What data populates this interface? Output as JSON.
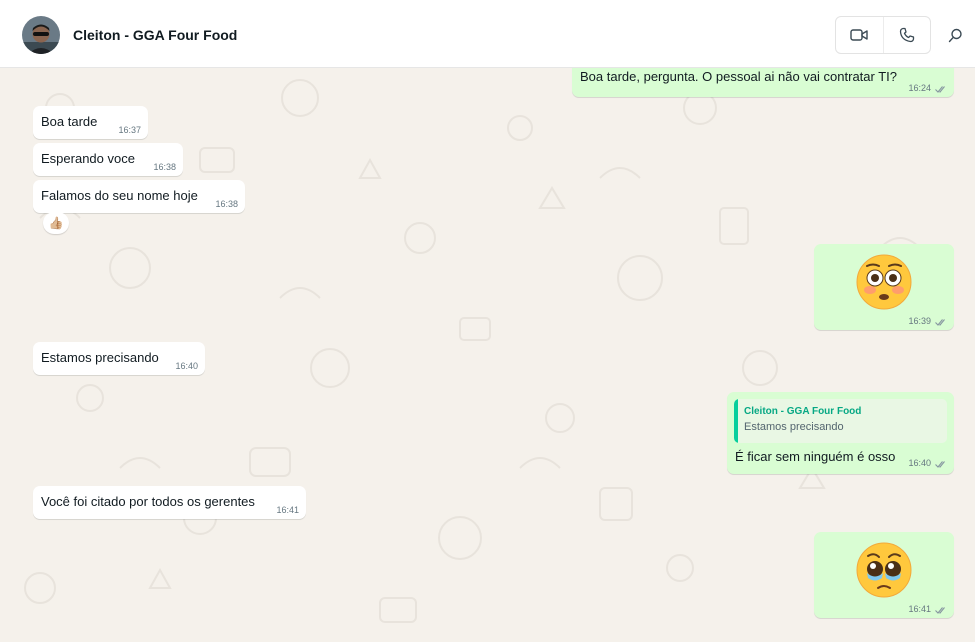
{
  "contact": {
    "name": "Cleiton - GGA Four Food"
  },
  "header_icons": [
    "video-call-icon",
    "voice-call-icon",
    "search-icon"
  ],
  "messages": [
    {
      "direction": "outgoing",
      "text": "Boa tarde, pergunta. O pessoal ai não vai contratar TI?",
      "time": "16:24",
      "status": "read"
    },
    {
      "direction": "incoming",
      "text": "Boa tarde",
      "time": "16:37"
    },
    {
      "direction": "incoming",
      "text": "Esperando voce",
      "time": "16:38"
    },
    {
      "direction": "incoming",
      "text": "Falamos do seu nome hoje",
      "time": "16:38",
      "reaction": "👍🏼"
    },
    {
      "direction": "outgoing",
      "emoji": "😳",
      "emoji_name": "flushed-face-emoji",
      "time": "16:39",
      "status": "read"
    },
    {
      "direction": "incoming",
      "text": "Estamos precisando",
      "time": "16:40"
    },
    {
      "direction": "outgoing",
      "quoted": {
        "author": "Cleiton - GGA Four Food",
        "text": "Estamos precisando"
      },
      "text": "É ficar sem ninguém é osso",
      "time": "16:40",
      "status": "read"
    },
    {
      "direction": "incoming",
      "text": "Você foi citado por todos os gerentes",
      "time": "16:41"
    },
    {
      "direction": "outgoing",
      "emoji": "🥹",
      "emoji_name": "face-holding-back-tears-emoji",
      "time": "16:41",
      "status": "read"
    }
  ],
  "colors": {
    "chat_background": "#f5f1eb",
    "incoming_bubble": "#ffffff",
    "outgoing_bubble": "#d9fdd3",
    "quote_accent": "#06cf9c",
    "read_ticks": "#8696a0"
  }
}
